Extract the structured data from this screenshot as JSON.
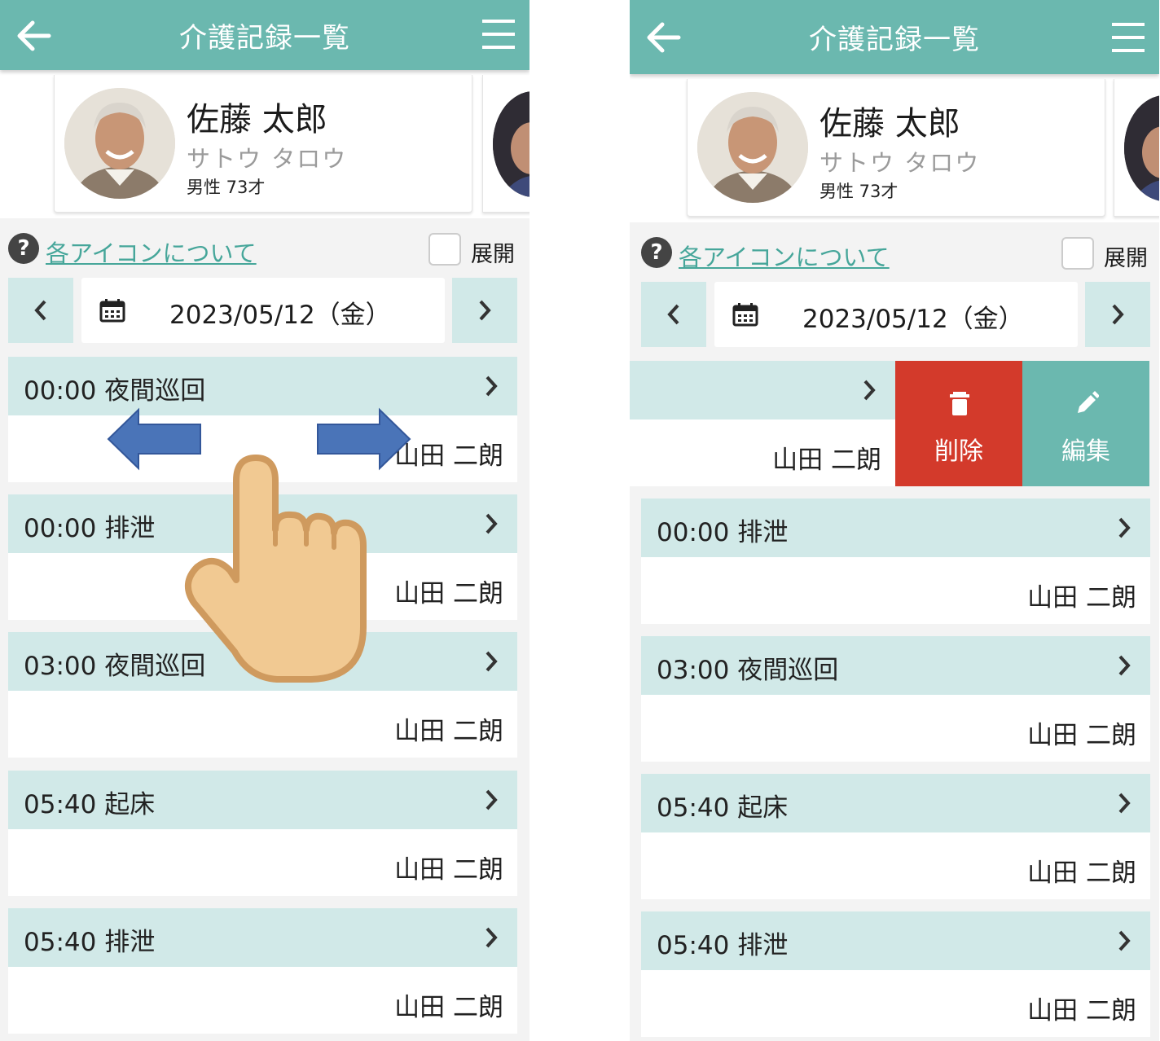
{
  "app": {
    "title": "介護記録一覧"
  },
  "profile": {
    "name": "佐藤 太郎",
    "kana": "サトウ タロウ",
    "info": "男性 73才"
  },
  "help": {
    "link_label": "各アイコンについて",
    "expand_label": "展開"
  },
  "date_nav": {
    "date": "2023/05/12（金）"
  },
  "records_left": [
    {
      "title": "00:00 夜間巡回",
      "staff": "山田 二朗"
    },
    {
      "title": "00:00 排泄",
      "staff": "山田 二朗"
    },
    {
      "title": "03:00 夜間巡回",
      "staff": "山田 二朗"
    },
    {
      "title": "05:40 起床",
      "staff": "山田 二朗"
    },
    {
      "title": "05:40 排泄",
      "staff": "山田 二朗"
    }
  ],
  "records_right": [
    {
      "title": "",
      "staff": "山田 二朗"
    },
    {
      "title": "00:00 排泄",
      "staff": "山田 二朗"
    },
    {
      "title": "03:00 夜間巡回",
      "staff": "山田 二朗"
    },
    {
      "title": "05:40 起床",
      "staff": "山田 二朗"
    },
    {
      "title": "05:40 排泄",
      "staff": "山田 二朗"
    }
  ],
  "swipe_actions": {
    "delete_label": "削除",
    "edit_label": "編集"
  },
  "colors": {
    "header": "#6bb8af",
    "row_header": "#d1e9e8",
    "delete": "#d33a2b",
    "link": "#46a69a"
  }
}
